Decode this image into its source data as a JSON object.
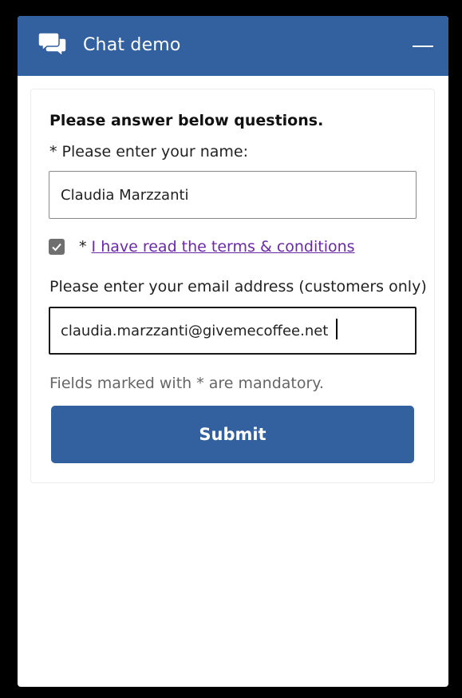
{
  "header": {
    "title": "Chat demo",
    "icon": "chat-bubbles-icon",
    "minimize_icon": "minimize-icon"
  },
  "form": {
    "intro": "Please answer below questions.",
    "name_label": "* Please enter your name:",
    "name_value": "Claudia Marzzanti",
    "terms_checked": true,
    "terms_prefix": "*",
    "terms_link": "I have read the terms & conditions",
    "email_label": "Please enter your email address (customers only)",
    "email_value": "claudia.marzzanti@givemecoffee.net",
    "mandatory_note": "Fields marked with * are mandatory.",
    "submit_label": "Submit"
  },
  "colors": {
    "brand": "#33609f",
    "link": "#6a2aa8",
    "checkbox": "#6f6f6f"
  }
}
